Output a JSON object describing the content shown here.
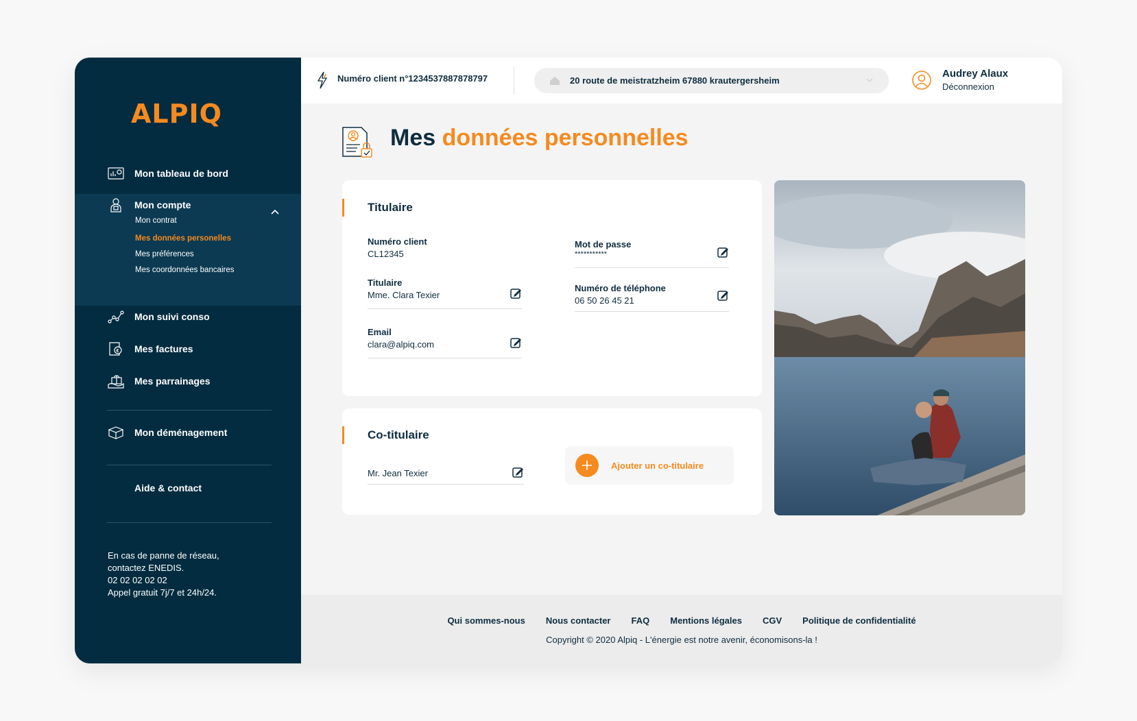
{
  "brand": {
    "logo": "ALPIQ",
    "accent": "#f58a1f",
    "navy": "#042c40"
  },
  "sidebar": {
    "items": [
      {
        "label": "Mon tableau de bord",
        "icon": "dashboard-icon"
      },
      {
        "label": "Mon compte",
        "icon": "account-icon"
      },
      {
        "label": "Mon suivi conso",
        "icon": "chart-line-icon"
      },
      {
        "label": "Mes factures",
        "icon": "invoice-icon"
      },
      {
        "label": "Mes parrainages",
        "icon": "gift-icon"
      },
      {
        "label": "Mon déménagement",
        "icon": "box-icon"
      },
      {
        "label": "Aide & contact"
      }
    ],
    "subitems": [
      {
        "label": "Mon contrat"
      },
      {
        "label": "Mes données personelles",
        "active": true
      },
      {
        "label": "Mes préférences"
      },
      {
        "label": "Mes coordonnées bancaires"
      }
    ],
    "info": {
      "line1": "En cas de panne de réseau,",
      "line2": "contactez ENEDIS.",
      "line3": "02 02 02 02 02",
      "line4": "Appel gratuit 7j/7 et 24h/24."
    }
  },
  "header": {
    "client_number": "Numéro client n°1234537887878797",
    "address": "20 route de meistratzheim 67880 krautergersheim",
    "user_name": "Audrey Alaux",
    "logout": "Déconnexion"
  },
  "page": {
    "title_part1": "Mes ",
    "title_part2": "données personnelles"
  },
  "titulaire": {
    "title": "Titulaire",
    "client_label": "Numéro client",
    "client_value": "CL12345",
    "holder_label": "Titulaire",
    "holder_value": "Mme. Clara Texier",
    "email_label": "Email",
    "email_value": "clara@alpiq.com",
    "password_label": "Mot de passe",
    "password_value": "***********",
    "phone_label": "Numéro de téléphone",
    "phone_value": "06 50 26 45 21"
  },
  "cotitulaire": {
    "title": "Co-titulaire",
    "name": "Mr. Jean Texier",
    "add_label": "Ajouter un co-titulaire"
  },
  "footer": {
    "links": [
      "Qui sommes-nous",
      "Nous contacter",
      "FAQ",
      "Mentions légales",
      "CGV",
      "Politique de confidentialité"
    ],
    "copyright": "Copyright © 2020 Alpiq - L'énergie est notre avenir, économisons-la !"
  }
}
